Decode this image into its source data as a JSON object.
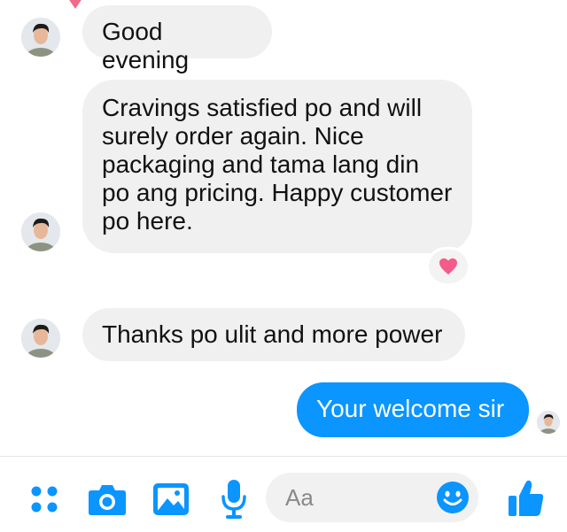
{
  "theme": {
    "accent": "#0a95ff",
    "incoming_bubble": "#f0f0f0",
    "reaction_heart": "#f35c8a"
  },
  "messages": [
    {
      "direction": "incoming",
      "text": "Good evening"
    },
    {
      "direction": "incoming",
      "text": "Cravings satisfied po and will surely order again. Nice packaging and tama lang din po ang pricing. Happy customer po here.",
      "reaction": "heart-icon"
    },
    {
      "direction": "incoming",
      "text": "Thanks po ulit and more power"
    },
    {
      "direction": "outgoing",
      "text": "Your welcome sir"
    }
  ],
  "composer": {
    "placeholder": "Aa",
    "tools": [
      "menu-dots-icon",
      "camera-icon",
      "gallery-icon",
      "microphone-icon"
    ],
    "emoji_icon": "smiley-icon",
    "send_icon": "thumbs-up-icon"
  }
}
